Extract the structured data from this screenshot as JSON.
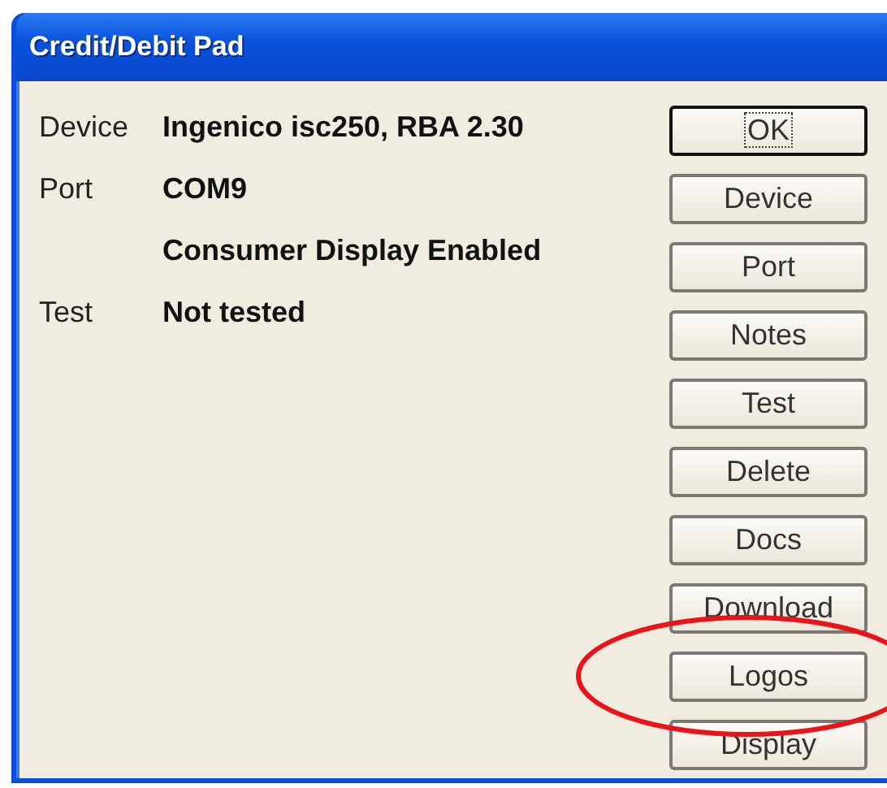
{
  "window": {
    "title": "Credit/Debit Pad"
  },
  "fields": [
    {
      "label": "Device",
      "value": "Ingenico isc250, RBA 2.30"
    },
    {
      "label": "Port",
      "value": "COM9"
    },
    {
      "value": "Consumer Display Enabled"
    },
    {
      "label": "Test",
      "value": "Not tested"
    }
  ],
  "buttons": [
    {
      "label": "OK",
      "focused": true
    },
    {
      "label": "Device",
      "focused": false
    },
    {
      "label": "Port",
      "focused": false
    },
    {
      "label": "Notes",
      "focused": false
    },
    {
      "label": "Test",
      "focused": false
    },
    {
      "label": "Delete",
      "focused": false
    },
    {
      "label": "Docs",
      "focused": false
    },
    {
      "label": "Download",
      "focused": false
    },
    {
      "label": "Logos",
      "focused": false,
      "highlighted": true
    },
    {
      "label": "Display",
      "focused": false
    }
  ]
}
